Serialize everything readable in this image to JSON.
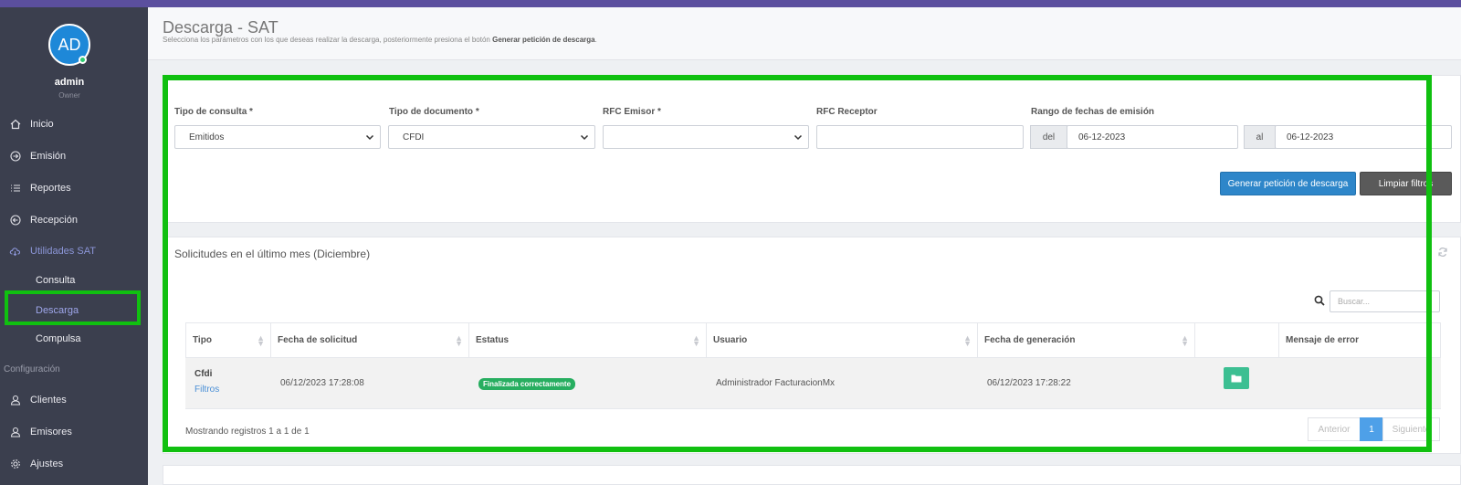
{
  "user": {
    "initials": "AD",
    "name": "admin",
    "role": "Owner"
  },
  "nav": {
    "items": [
      {
        "label": "Inicio",
        "icon": "home-icon"
      },
      {
        "label": "Emisión",
        "icon": "arrow-circle-right-icon"
      },
      {
        "label": "Reportes",
        "icon": "list-icon"
      },
      {
        "label": "Recepción",
        "icon": "arrow-circle-left-icon"
      },
      {
        "label": "Utilidades SAT",
        "icon": "cloud-download-icon"
      }
    ],
    "sub_items": [
      "Consulta",
      "Descarga",
      "Compulsa"
    ],
    "config_label": "Configuración",
    "config_items": [
      {
        "label": "Clientes",
        "icon": "user-icon"
      },
      {
        "label": "Emisores",
        "icon": "user-icon"
      },
      {
        "label": "Ajustes",
        "icon": "gear-icon"
      }
    ]
  },
  "header": {
    "title": "Descarga - SAT",
    "subtitle": "Selecciona los parámetros con los que deseas realizar la descarga, posteriormente presiona el botón",
    "subtitle_bold": "Generar petición de descarga",
    "subtitle_end": "."
  },
  "filters": {
    "tipo_consulta": {
      "label": "Tipo de consulta *",
      "value": "Emitidos"
    },
    "tipo_documento": {
      "label": "Tipo de documento *",
      "value": "CFDI"
    },
    "rfc_emisor": {
      "label": "RFC Emisor *",
      "value": ""
    },
    "rfc_receptor": {
      "label": "RFC Receptor",
      "value": ""
    },
    "rango": {
      "label": "Rango de fechas de emisión",
      "del_label": "del",
      "del_value": "06-12-2023",
      "al_label": "al",
      "al_value": "06-12-2023"
    },
    "generate_button": "Generar petición de descarga",
    "clear_button": "Limpiar filtros"
  },
  "requests": {
    "title": "Solicitudes en el último mes (Diciembre)",
    "search_placeholder": "Buscar...",
    "columns": [
      "Tipo",
      "Fecha de solicitud",
      "Estatus",
      "Usuario",
      "Fecha de generación",
      "",
      "Mensaje de error"
    ],
    "rows": [
      {
        "tipo": "Cfdi",
        "filtros_link": "Filtros",
        "fecha_solicitud": "06/12/2023 17:28:08",
        "estatus": "Finalizada correctamente",
        "usuario": "Administrador FacturacionMx",
        "fecha_generacion": "06/12/2023 17:28:22",
        "mensaje_error": ""
      }
    ],
    "summary": "Mostrando registros 1 a 1 de 1",
    "pagination": {
      "prev": "Anterior",
      "current": "1",
      "next": "Siguiente"
    }
  },
  "colors": {
    "primary": "#2e86c9",
    "success": "#27ae60",
    "sidebar": "#3b3f4e",
    "highlight": "#10c010"
  }
}
